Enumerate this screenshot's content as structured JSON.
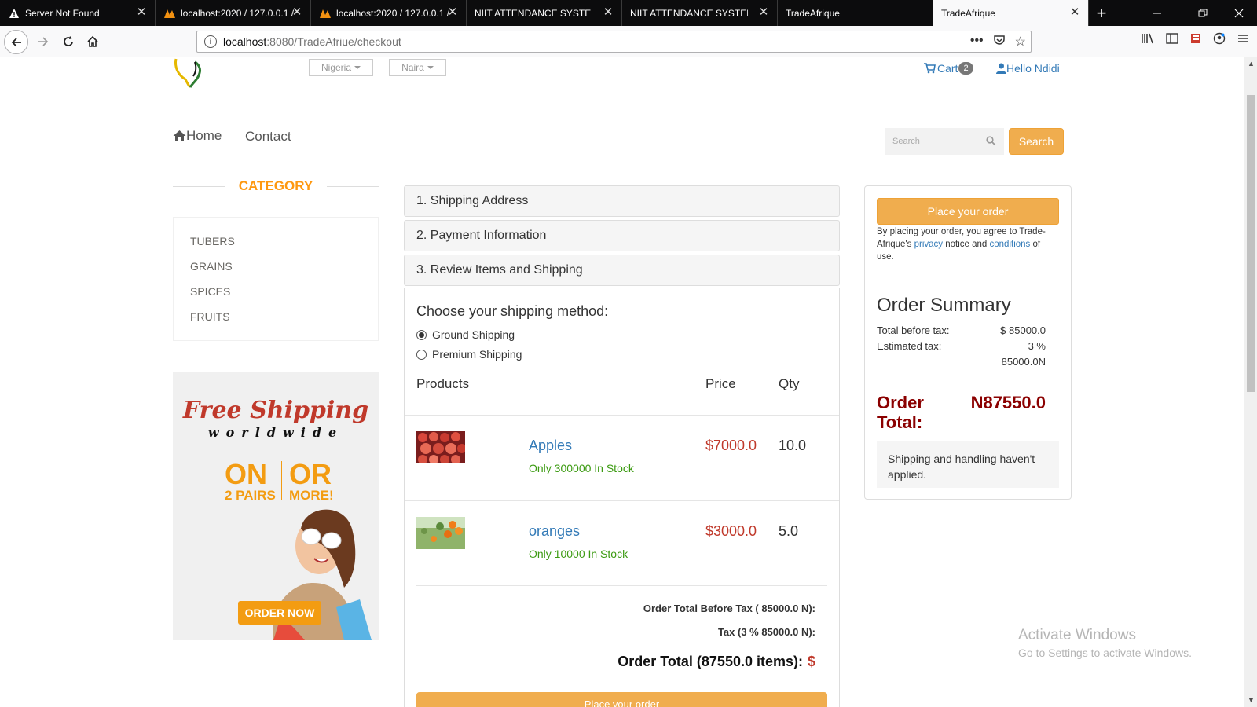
{
  "browser": {
    "tabs": [
      {
        "title": "Server Not Found",
        "icon": "warning-icon",
        "active": false
      },
      {
        "title": "localhost:2020 / 127.0.0.1 /",
        "icon": "phpmyadmin-icon",
        "active": false
      },
      {
        "title": "localhost:2020 / 127.0.0.1 /",
        "icon": "phpmyadmin-icon",
        "active": false
      },
      {
        "title": "NIIT ATTENDANCE SYSTEM",
        "icon": "",
        "active": false
      },
      {
        "title": "NIIT ATTENDANCE SYSTEM",
        "icon": "",
        "active": false
      },
      {
        "title": "TradeAfrique",
        "icon": "",
        "active": false
      },
      {
        "title": "TradeAfrique",
        "icon": "",
        "active": true
      }
    ],
    "url_host": "localhost",
    "url_rest": ":8080/TradeAfriue/checkout"
  },
  "header": {
    "country": "Nigeria",
    "currency": "Naira",
    "cart_label": "Cart",
    "cart_count": "2",
    "user_label": "Hello Ndidi"
  },
  "menu": {
    "home": "Home",
    "contact": "Contact",
    "search_placeholder": "Search",
    "search_button": "Search"
  },
  "sidebar": {
    "title": "CATEGORY",
    "categories": [
      "TUBERS",
      "GRAINS",
      "SPICES",
      "FRUITS"
    ],
    "promo": {
      "line1": "Free Shipping",
      "line2": "worldwide",
      "on": "ON",
      "or": "OR",
      "pairs": "2 PAIRS",
      "more": "MORE!",
      "cta": "ORDER NOW"
    }
  },
  "checkout": {
    "step1": "1. Shipping Address",
    "step2": "2. Payment Information",
    "step3": "3. Review Items and Shipping",
    "shipping_heading": "Choose your shipping method:",
    "shipping_options": [
      {
        "label": "Ground Shipping",
        "checked": true
      },
      {
        "label": "Premium Shipping",
        "checked": false
      }
    ],
    "columns": {
      "products": "Products",
      "price": "Price",
      "qty": "Qty"
    },
    "items": [
      {
        "name": "Apples",
        "stock": "Only 300000 In Stock",
        "price": "$7000.0",
        "qty": "10.0"
      },
      {
        "name": "oranges",
        "stock": "Only 10000 In Stock",
        "price": "$3000.0",
        "qty": "5.0"
      }
    ],
    "total_before_tax_line": "Order Total Before Tax ( 85000.0 N):",
    "tax_line": "Tax (3 % 85000.0 N):",
    "order_total_line": "Order Total (87550.0 items):",
    "order_total_currency": "$",
    "bottom_button": "Place your order"
  },
  "summary": {
    "place_order": "Place your order",
    "agree_prefix": "By placing your order, you agree to Trade-Afrique's",
    "privacy": "privacy",
    "agree_mid": "notice and",
    "conditions": "conditions",
    "agree_suffix": "of use.",
    "title": "Order Summary",
    "total_before_tax_label": "Total before tax:",
    "total_before_tax_value": "$ 85000.0",
    "estimated_tax_label": "Estimated tax:",
    "estimated_tax_value": "3 %",
    "estimated_tax_value2": "85000.0N",
    "order_total_label": "Order Total:",
    "order_total_value": "N87550.0",
    "note": "Shipping and handling haven't applied."
  },
  "watermark": {
    "title": "Activate Windows",
    "subtitle": "Go to Settings to activate Windows."
  },
  "colors": {
    "accent": "#f0ad4e",
    "link": "#337ab7",
    "price": "#c0392b",
    "order_total": "#8b0000",
    "category_title": "#fe980f"
  }
}
